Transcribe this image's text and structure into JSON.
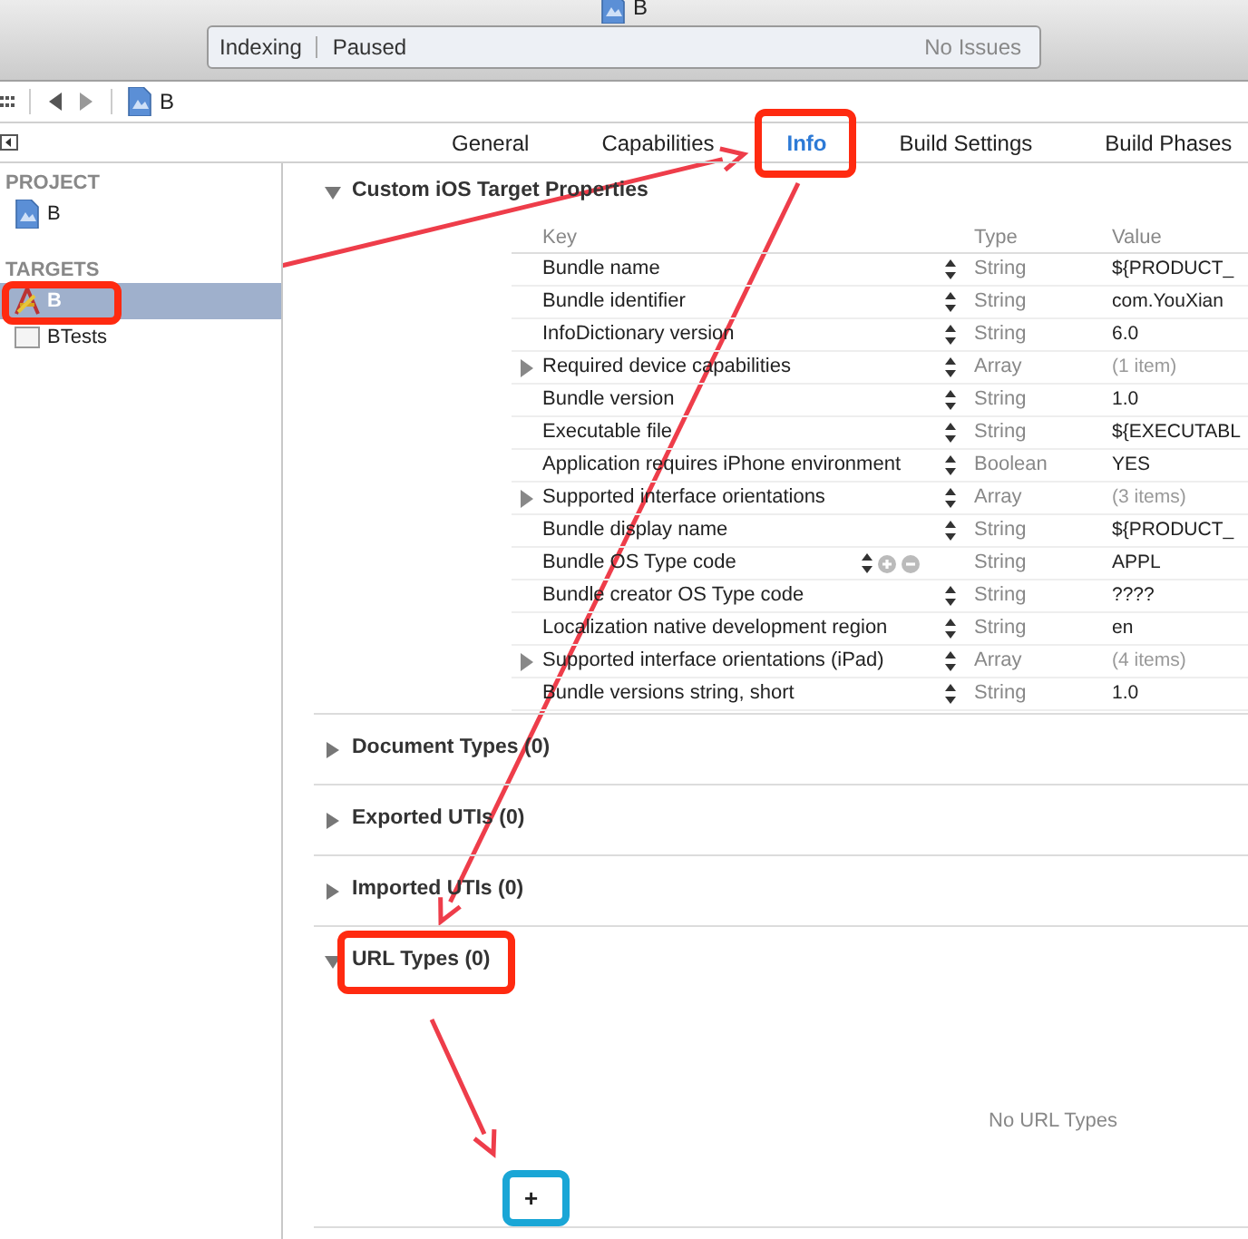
{
  "window": {
    "title": "B"
  },
  "activity": {
    "status": "Indexing",
    "detail": "Paused",
    "issues": "No Issues"
  },
  "jump_bar": {
    "item": "B"
  },
  "tabs": [
    {
      "label": "General",
      "selected": false
    },
    {
      "label": "Capabilities",
      "selected": false
    },
    {
      "label": "Info",
      "selected": true
    },
    {
      "label": "Build Settings",
      "selected": false
    },
    {
      "label": "Build Phases",
      "selected": false
    }
  ],
  "sidebar": {
    "groups": [
      {
        "heading": "PROJECT",
        "items": [
          {
            "label": "B",
            "kind": "project",
            "selected": false
          }
        ]
      },
      {
        "heading": "TARGETS",
        "items": [
          {
            "label": "B",
            "kind": "app",
            "selected": true
          },
          {
            "label": "BTests",
            "kind": "bundle",
            "selected": false
          }
        ]
      }
    ]
  },
  "sections": [
    {
      "title": "Custom iOS Target Properties",
      "expanded": true,
      "kind": "properties",
      "columns": [
        "Key",
        "Type",
        "Value"
      ],
      "rows": [
        {
          "key": "Bundle name",
          "type": "String",
          "value": "${PRODUCT_",
          "expandable": false,
          "hovered": false
        },
        {
          "key": "Bundle identifier",
          "type": "String",
          "value": "com.YouXian",
          "expandable": false,
          "hovered": false
        },
        {
          "key": "InfoDictionary version",
          "type": "String",
          "value": "6.0",
          "expandable": false,
          "hovered": false
        },
        {
          "key": "Required device capabilities",
          "type": "Array",
          "value": "(1 item)",
          "expandable": true,
          "hovered": false
        },
        {
          "key": "Bundle version",
          "type": "String",
          "value": "1.0",
          "expandable": false,
          "hovered": false
        },
        {
          "key": "Executable file",
          "type": "String",
          "value": "${EXECUTABL",
          "expandable": false,
          "hovered": false
        },
        {
          "key": "Application requires iPhone environment",
          "type": "Boolean",
          "value": "YES",
          "expandable": false,
          "hovered": false
        },
        {
          "key": "Supported interface orientations",
          "type": "Array",
          "value": "(3 items)",
          "expandable": true,
          "hovered": false
        },
        {
          "key": "Bundle display name",
          "type": "String",
          "value": "${PRODUCT_",
          "expandable": false,
          "hovered": false
        },
        {
          "key": "Bundle OS Type code",
          "type": "String",
          "value": "APPL",
          "expandable": false,
          "hovered": true
        },
        {
          "key": "Bundle creator OS Type code",
          "type": "String",
          "value": "????",
          "expandable": false,
          "hovered": false
        },
        {
          "key": "Localization native development region",
          "type": "String",
          "value": "en",
          "expandable": false,
          "hovered": false
        },
        {
          "key": "Supported interface orientations (iPad)",
          "type": "Array",
          "value": "(4 items)",
          "expandable": true,
          "hovered": false
        },
        {
          "key": "Bundle versions string, short",
          "type": "String",
          "value": "1.0",
          "expandable": false,
          "hovered": false
        }
      ]
    },
    {
      "title": "Document Types (0)",
      "expanded": false,
      "kind": "list"
    },
    {
      "title": "Exported UTIs (0)",
      "expanded": false,
      "kind": "list"
    },
    {
      "title": "Imported UTIs (0)",
      "expanded": false,
      "kind": "list"
    },
    {
      "title": "URL Types (0)",
      "expanded": true,
      "kind": "list",
      "empty_text": "No URL Types",
      "add_button": "+"
    }
  ]
}
